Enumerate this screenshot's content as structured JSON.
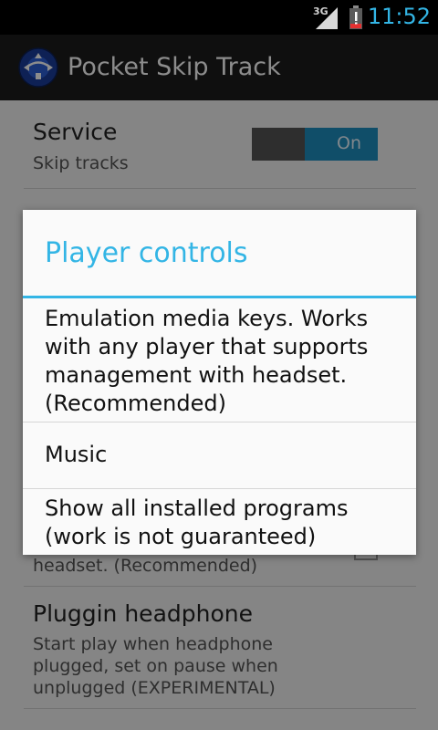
{
  "status_bar": {
    "network": "3G",
    "time": "11:52"
  },
  "action_bar": {
    "title": "Pocket Skip Track"
  },
  "settings": {
    "service": {
      "title": "Service",
      "summary": "Skip tracks",
      "toggle_label": "On"
    },
    "player_summary_tail": "headset. (Recommended)",
    "pluggin": {
      "title": "Pluggin headphone",
      "summary_lines": [
        "Start play when headphone",
        "plugged, set on pause when",
        "unplugged (EXPERIMENTAL)"
      ],
      "checked": false
    }
  },
  "dialog": {
    "title": "Player controls",
    "options": [
      "Emulation media keys. Works with any player that supports management with headset. (Recommended)",
      "Music",
      "Show all installed programs (work is not guaranteed)"
    ]
  },
  "colors": {
    "accent": "#33b5e5",
    "toggle_on": "#1e8fbf"
  },
  "icons": {
    "signal": "signal-bars-icon",
    "battery": "battery-low-icon",
    "app": "app-logo-icon"
  }
}
